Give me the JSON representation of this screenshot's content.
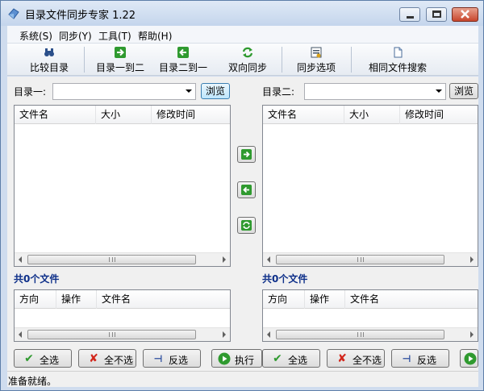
{
  "window": {
    "title": "目录文件同步专家 1.22"
  },
  "menu": [
    "系统(S)",
    "同步(Y)",
    "工具(T)",
    "帮助(H)"
  ],
  "toolbar": {
    "compare": "比较目录",
    "one_to_two": "目录一到二",
    "two_to_one": "目录二到一",
    "bidirectional": "双向同步",
    "options": "同步选项",
    "same_file_search": "相同文件搜索"
  },
  "left": {
    "dir_label": "目录一:",
    "dir_value": "",
    "browse": "浏览",
    "columns": [
      "文件名",
      "大小",
      "修改时间"
    ],
    "count": "共0个文件",
    "op_columns": [
      "方向",
      "操作",
      "文件名"
    ]
  },
  "right": {
    "dir_label": "目录二:",
    "dir_value": "",
    "browse": "浏览",
    "columns": [
      "文件名",
      "大小",
      "修改时间"
    ],
    "count": "共0个文件",
    "op_columns": [
      "方向",
      "操作",
      "文件名"
    ]
  },
  "buttons": {
    "select_all": "全选",
    "select_none": "全不选",
    "invert": "反选",
    "execute": "执行"
  },
  "status": "准备就绪。",
  "colors": {
    "accent": "#2f9a2f",
    "count_text": "#0d2f89",
    "title_bg": "#cfdcee"
  }
}
